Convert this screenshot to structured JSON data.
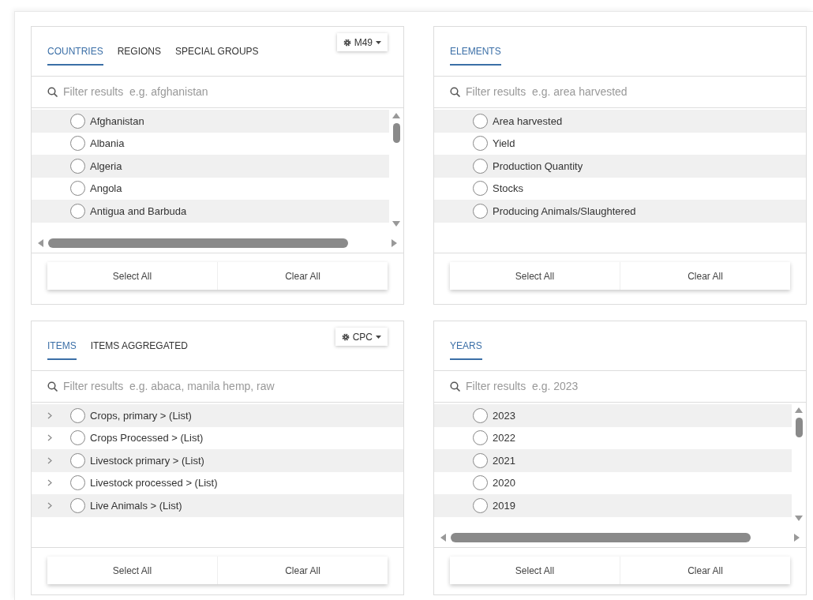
{
  "panels": [
    {
      "tabs": [
        {
          "label": "COUNTRIES",
          "selected": true
        },
        {
          "label": "REGIONS",
          "selected": false
        },
        {
          "label": "SPECIAL GROUPS",
          "selected": false
        }
      ],
      "dropdown": {
        "label": "M49"
      },
      "search": {
        "placeholder": "Filter results  e.g. afghanistan"
      },
      "scrollable": true,
      "rows": [
        {
          "label": "Afghanistan",
          "selected": false,
          "kind": "plain"
        },
        {
          "label": "Albania",
          "selected": false,
          "kind": "plain"
        },
        {
          "label": "Algeria",
          "selected": false,
          "kind": "plain"
        },
        {
          "label": "Angola",
          "selected": false,
          "kind": "plain"
        },
        {
          "label": "Antigua and Barbuda",
          "selected": false,
          "kind": "plain"
        }
      ],
      "buttons": [
        "Select All",
        "Clear All"
      ]
    },
    {
      "tabs": [
        {
          "label": "ELEMENTS",
          "selected": true
        }
      ],
      "search": {
        "placeholder": "Filter results  e.g. area harvested"
      },
      "scrollable": false,
      "rows": [
        {
          "label": "Area harvested",
          "selected": false,
          "kind": "plain"
        },
        {
          "label": "Yield",
          "selected": false,
          "kind": "plain"
        },
        {
          "label": "Production Quantity",
          "selected": false,
          "kind": "plain"
        },
        {
          "label": "Stocks",
          "selected": false,
          "kind": "plain"
        },
        {
          "label": "Producing Animals/Slaughtered",
          "selected": false,
          "kind": "plain"
        }
      ],
      "buttons": [
        "Select All",
        "Clear All"
      ]
    },
    {
      "tabs": [
        {
          "label": "ITEMS",
          "selected": true
        },
        {
          "label": "ITEMS AGGREGATED",
          "selected": false
        }
      ],
      "dropdown": {
        "label": "CPC"
      },
      "search": {
        "placeholder": "Filter results  e.g. abaca, manila hemp, raw"
      },
      "scrollable": false,
      "rows": [
        {
          "label": "Crops, primary > (List)",
          "selected": false,
          "kind": "tree"
        },
        {
          "label": "Crops Processed > (List)",
          "selected": false,
          "kind": "tree"
        },
        {
          "label": "Livestock primary > (List)",
          "selected": false,
          "kind": "tree"
        },
        {
          "label": "Livestock processed > (List)",
          "selected": false,
          "kind": "tree"
        },
        {
          "label": "Live Animals > (List)",
          "selected": false,
          "kind": "tree"
        }
      ],
      "buttons": [
        "Select All",
        "Clear All"
      ]
    },
    {
      "tabs": [
        {
          "label": "YEARS",
          "selected": true
        }
      ],
      "search": {
        "placeholder": "Filter results  e.g. 2023"
      },
      "scrollable": true,
      "rows": [
        {
          "label": "2023",
          "selected": false,
          "kind": "plain"
        },
        {
          "label": "2022",
          "selected": false,
          "kind": "plain"
        },
        {
          "label": "2021",
          "selected": false,
          "kind": "plain"
        },
        {
          "label": "2020",
          "selected": false,
          "kind": "plain"
        },
        {
          "label": "2019",
          "selected": false,
          "kind": "plain"
        }
      ],
      "buttons": [
        "Select All",
        "Clear All"
      ]
    }
  ]
}
